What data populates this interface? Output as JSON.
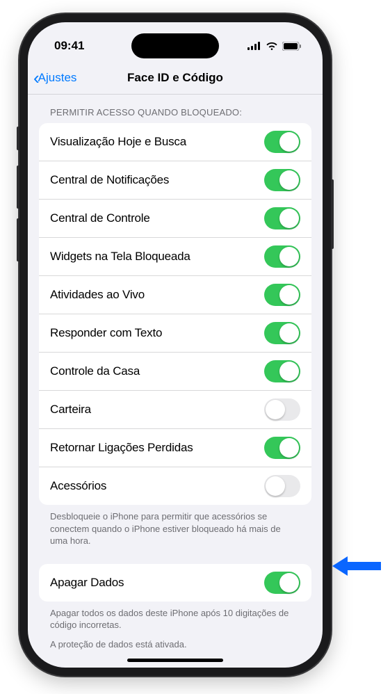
{
  "statusbar": {
    "time": "09:41"
  },
  "nav": {
    "back": "Ajustes",
    "title": "Face ID e Código"
  },
  "lockAccess": {
    "header": "Permitir acesso quando bloqueado:",
    "items": [
      {
        "label": "Visualização Hoje e Busca",
        "on": true
      },
      {
        "label": "Central de Notificações",
        "on": true
      },
      {
        "label": "Central de Controle",
        "on": true
      },
      {
        "label": "Widgets na Tela Bloqueada",
        "on": true
      },
      {
        "label": "Atividades ao Vivo",
        "on": true
      },
      {
        "label": "Responder com Texto",
        "on": true
      },
      {
        "label": "Controle da Casa",
        "on": true
      },
      {
        "label": "Carteira",
        "on": false
      },
      {
        "label": "Retornar Ligações Perdidas",
        "on": true
      },
      {
        "label": "Acessórios",
        "on": false
      }
    ],
    "footer": "Desbloqueie o iPhone para permitir que acessórios se conectem quando o iPhone estiver bloqueado há mais de uma hora."
  },
  "eraseData": {
    "label": "Apagar Dados",
    "on": true,
    "footer1": "Apagar todos os dados deste iPhone após 10 digitações de código incorretas.",
    "footer2": "A proteção de dados está ativada."
  }
}
